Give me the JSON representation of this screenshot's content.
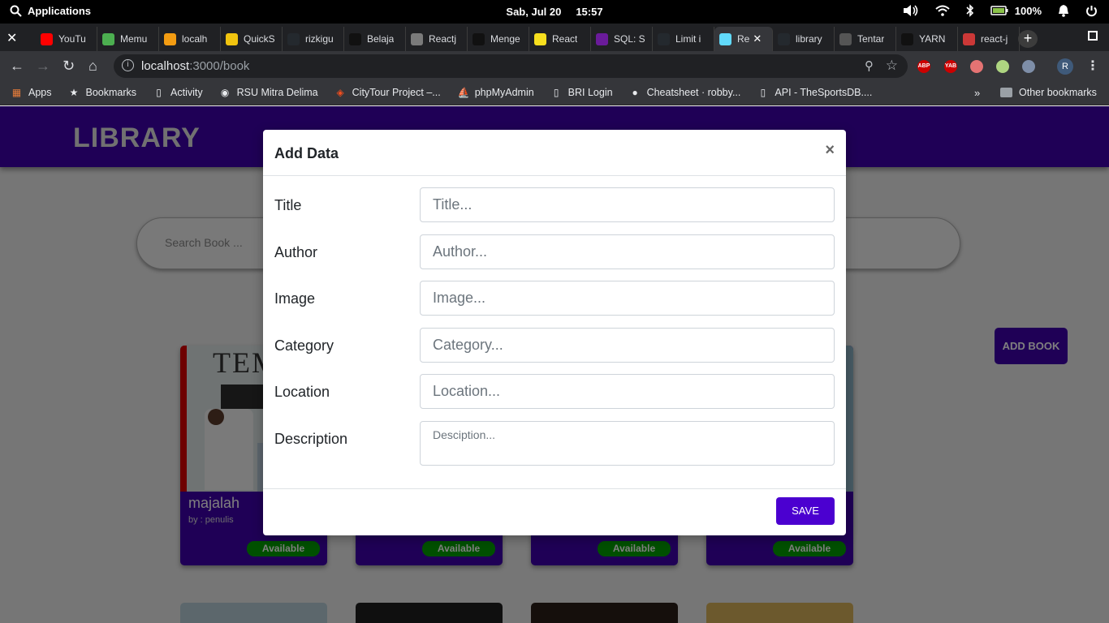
{
  "system_bar": {
    "apps_label": "Applications",
    "date": "Sab, Jul 20",
    "time": "15:57",
    "battery": "100%"
  },
  "browser": {
    "tabs": [
      {
        "label": "YouTu",
        "icon": "youtube-icon",
        "color": "#ff0000"
      },
      {
        "label": "Memu",
        "icon": "leaf-icon",
        "color": "#4caf50"
      },
      {
        "label": "localh",
        "icon": "phpmyadmin-icon",
        "color": "#f39c12"
      },
      {
        "label": "QuickS",
        "icon": "quickstart-icon",
        "color": "#f1c40f"
      },
      {
        "label": "rizkigu",
        "icon": "github-icon",
        "color": "#24292e"
      },
      {
        "label": "Belaja",
        "icon": "medium-icon",
        "color": "#111111"
      },
      {
        "label": "Reactj",
        "icon": "reactjs-icon",
        "color": "#7a7a7a"
      },
      {
        "label": "Menge",
        "icon": "medium-icon",
        "color": "#111111"
      },
      {
        "label": "React",
        "icon": "scrimba-icon",
        "color": "#f7df1e"
      },
      {
        "label": "SQL: S",
        "icon": "sql-icon",
        "color": "#6a1b9a"
      },
      {
        "label": "Limit i",
        "icon": "github-icon",
        "color": "#24292e"
      },
      {
        "label": "Re",
        "icon": "react-icon",
        "color": "#61dafb",
        "active": true
      },
      {
        "label": "library",
        "icon": "github-icon",
        "color": "#24292e"
      },
      {
        "label": "Tentar",
        "icon": "document-icon",
        "color": "#555555"
      },
      {
        "label": "YARN",
        "icon": "medium-icon",
        "color": "#111111"
      },
      {
        "label": "react-j",
        "icon": "npm-icon",
        "color": "#cb3837"
      }
    ],
    "url_host": "localhost",
    "url_path": ":3000/book",
    "extensions": [
      {
        "label": "ABP",
        "color": "#c00"
      },
      {
        "label": "YAB",
        "color": "#c00"
      },
      {
        "label": "",
        "color": "#e57373"
      },
      {
        "label": "",
        "color": "#aed581"
      },
      {
        "label": "",
        "color": "#7e8ea8"
      }
    ],
    "profile_initial": "R"
  },
  "bookmarks": [
    {
      "label": "Apps",
      "icon": "apps-grid-icon"
    },
    {
      "label": "Bookmarks",
      "icon": "star-icon"
    },
    {
      "label": "Activity",
      "icon": "page-icon"
    },
    {
      "label": "RSU Mitra Delima",
      "icon": "chrome-icon"
    },
    {
      "label": "CityTour Project –...",
      "icon": "figma-icon"
    },
    {
      "label": "phpMyAdmin",
      "icon": "phpmyadmin-icon"
    },
    {
      "label": "BRI Login",
      "icon": "page-icon"
    },
    {
      "label": "Cheatsheet · robby...",
      "icon": "github-icon"
    },
    {
      "label": "API - TheSportsDB....",
      "icon": "page-icon"
    }
  ],
  "bookmarks_more": "»",
  "bookmarks_other": "Other bookmarks",
  "app": {
    "logo": "LIBRARY",
    "search_placeholder": "Search Book ...",
    "add_book_label": "ADD BOOK",
    "cards": [
      {
        "title": "majalah",
        "author": "by : penulis",
        "status": "Available"
      },
      {
        "title": "",
        "author": "",
        "status": "Available"
      },
      {
        "title": "",
        "author": "",
        "status": "Available"
      },
      {
        "title": "",
        "author": "",
        "status": "Available"
      }
    ]
  },
  "modal": {
    "title": "Add Data",
    "close": "×",
    "fields": [
      {
        "label": "Title",
        "placeholder": "Title..."
      },
      {
        "label": "Author",
        "placeholder": "Author..."
      },
      {
        "label": "Image",
        "placeholder": "Image..."
      },
      {
        "label": "Category",
        "placeholder": "Category..."
      },
      {
        "label": "Location",
        "placeholder": "Location..."
      },
      {
        "label": "Description",
        "placeholder": "Desciption..."
      }
    ],
    "save_label": "SAVE"
  },
  "colors": {
    "primary": "#3f00ad",
    "save_button": "#4b00d0",
    "available": "#00a000"
  }
}
